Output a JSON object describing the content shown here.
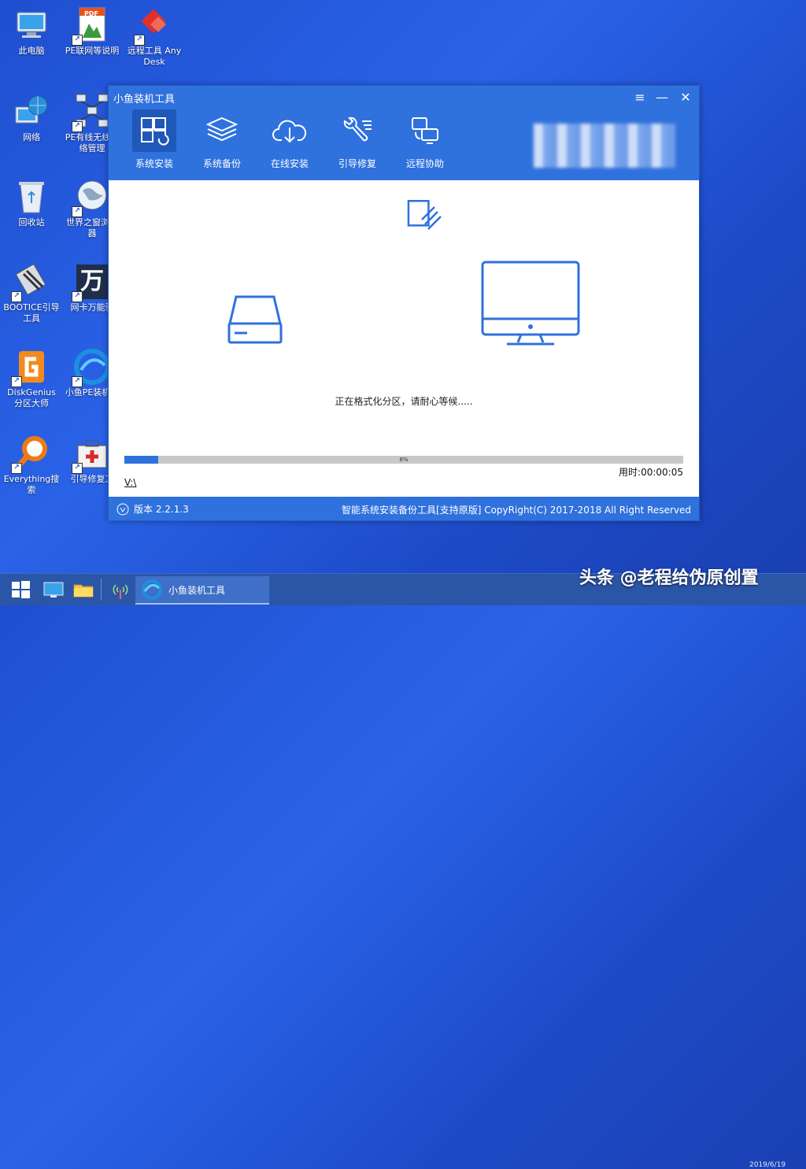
{
  "desktop": {
    "icons": [
      {
        "label": "此电脑"
      },
      {
        "label": "PE联网等说明"
      },
      {
        "label": "远程工具 AnyDesk"
      },
      {
        "label": "网络"
      },
      {
        "label": "PE有线无线网络管理"
      },
      {
        "label": "回收站"
      },
      {
        "label": "世界之窗浏览器"
      },
      {
        "label": "BOOTICE引导工具"
      },
      {
        "label": "网卡万能驱"
      },
      {
        "label": "DiskGenius 分区大师"
      },
      {
        "label": "小鱼PE装机具"
      },
      {
        "label": "Everything搜索"
      },
      {
        "label": "引导修复工"
      }
    ],
    "icon_badges": {
      "pdf": "PDF",
      "wan": "万"
    }
  },
  "window": {
    "title": "小鱼装机工具",
    "controls": {
      "menu": "≡",
      "minimize": "—",
      "close": "✕"
    },
    "nav": [
      {
        "label": "系统安装",
        "active": true
      },
      {
        "label": "系统备份"
      },
      {
        "label": "在线安装"
      },
      {
        "label": "引导修复"
      },
      {
        "label": "远程协助"
      }
    ],
    "status_text": "正在格式化分区，请耐心等候.....",
    "progress": {
      "percent": 6,
      "label": "6%"
    },
    "drive_label": "V:\\",
    "elapsed": "用时:00:00:05",
    "footer": {
      "version": "版本 2.2.1.3",
      "copyright": "智能系统安装备份工具[支持原版]  CopyRight(C) 2017-2018 All Right Reserved"
    }
  },
  "taskbar": {
    "active_task": "小鱼装机工具",
    "clock_date": "2019/6/19"
  },
  "watermark": "头条 @老程给伪原创置",
  "colors": {
    "accent": "#2f71dd",
    "desktop": "#2a63e8",
    "taskbar": "#2b56a8"
  }
}
